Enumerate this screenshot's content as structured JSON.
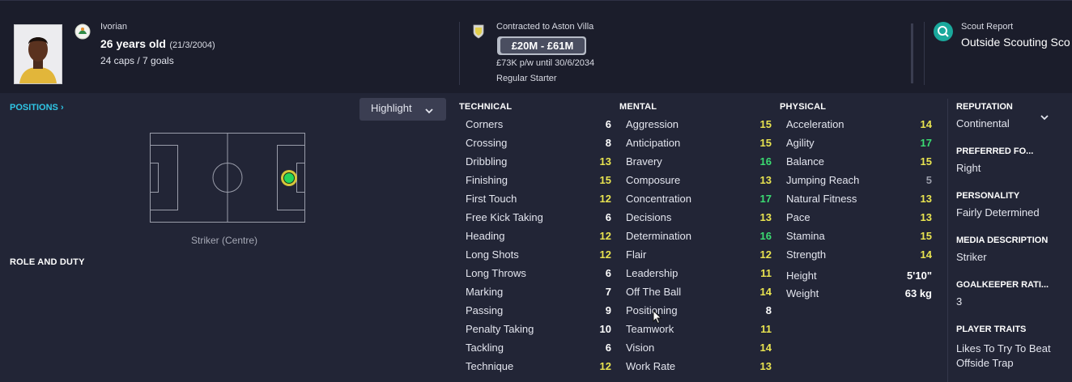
{
  "header": {
    "nationality": "Ivorian",
    "age_text": "26 years old",
    "dob_text": "(21/3/2004)",
    "caps_goals": "24 caps / 7 goals",
    "contract_label": "Contracted to Aston Villa",
    "value_range": "£20M - £61M",
    "wage_text": "£73K p/w until 30/6/2034",
    "squad_status": "Regular Starter",
    "scout_label": "Scout Report",
    "scout_value": "Outside Scouting Sco"
  },
  "left": {
    "positions_label": "POSITIONS",
    "highlight_label": "Highlight",
    "position_name": "Striker (Centre)",
    "role_duty_label": "ROLE AND DUTY"
  },
  "columns": {
    "technical": {
      "title": "TECHNICAL",
      "rows": [
        {
          "name": "Corners",
          "value": "6",
          "level": "white"
        },
        {
          "name": "Crossing",
          "value": "8",
          "level": "white"
        },
        {
          "name": "Dribbling",
          "value": "13",
          "level": "yellow"
        },
        {
          "name": "Finishing",
          "value": "15",
          "level": "yellow"
        },
        {
          "name": "First Touch",
          "value": "12",
          "level": "yellow"
        },
        {
          "name": "Free Kick Taking",
          "value": "6",
          "level": "white"
        },
        {
          "name": "Heading",
          "value": "12",
          "level": "yellow"
        },
        {
          "name": "Long Shots",
          "value": "12",
          "level": "yellow"
        },
        {
          "name": "Long Throws",
          "value": "6",
          "level": "white"
        },
        {
          "name": "Marking",
          "value": "7",
          "level": "white"
        },
        {
          "name": "Passing",
          "value": "9",
          "level": "white"
        },
        {
          "name": "Penalty Taking",
          "value": "10",
          "level": "white"
        },
        {
          "name": "Tackling",
          "value": "6",
          "level": "white"
        },
        {
          "name": "Technique",
          "value": "12",
          "level": "yellow"
        }
      ]
    },
    "mental": {
      "title": "MENTAL",
      "rows": [
        {
          "name": "Aggression",
          "value": "15",
          "level": "yellow"
        },
        {
          "name": "Anticipation",
          "value": "15",
          "level": "yellow"
        },
        {
          "name": "Bravery",
          "value": "16",
          "level": "green"
        },
        {
          "name": "Composure",
          "value": "13",
          "level": "yellow"
        },
        {
          "name": "Concentration",
          "value": "17",
          "level": "green"
        },
        {
          "name": "Decisions",
          "value": "13",
          "level": "yellow"
        },
        {
          "name": "Determination",
          "value": "16",
          "level": "green"
        },
        {
          "name": "Flair",
          "value": "12",
          "level": "yellow"
        },
        {
          "name": "Leadership",
          "value": "11",
          "level": "yellow"
        },
        {
          "name": "Off The Ball",
          "value": "14",
          "level": "yellow"
        },
        {
          "name": "Positioning",
          "value": "8",
          "level": "white"
        },
        {
          "name": "Teamwork",
          "value": "11",
          "level": "yellow"
        },
        {
          "name": "Vision",
          "value": "14",
          "level": "yellow"
        },
        {
          "name": "Work Rate",
          "value": "13",
          "level": "yellow"
        }
      ]
    },
    "physical": {
      "title": "PHYSICAL",
      "rows": [
        {
          "name": "Acceleration",
          "value": "14",
          "level": "yellow"
        },
        {
          "name": "Agility",
          "value": "17",
          "level": "green"
        },
        {
          "name": "Balance",
          "value": "15",
          "level": "yellow"
        },
        {
          "name": "Jumping Reach",
          "value": "5",
          "level": "grey"
        },
        {
          "name": "Natural Fitness",
          "value": "13",
          "level": "yellow"
        },
        {
          "name": "Pace",
          "value": "13",
          "level": "yellow"
        },
        {
          "name": "Stamina",
          "value": "15",
          "level": "yellow"
        },
        {
          "name": "Strength",
          "value": "14",
          "level": "yellow"
        }
      ],
      "height_label": "Height",
      "height_value": "5'10\"",
      "weight_label": "Weight",
      "weight_value": "63 kg"
    }
  },
  "info": {
    "reputation_label": "REPUTATION",
    "reputation_value": "Continental",
    "foot_label": "PREFERRED FO...",
    "foot_value": "Right",
    "personality_label": "PERSONALITY",
    "personality_value": "Fairly Determined",
    "media_label": "MEDIA DESCRIPTION",
    "media_value": "Striker",
    "gk_label": "GOALKEEPER RATI...",
    "gk_value": "3",
    "traits_label": "PLAYER TRAITS",
    "traits_value_1": "Likes To Try To Beat",
    "traits_value_2": "Offside Trap"
  },
  "colors": {
    "white": "#ffffff",
    "yellow": "#e9e450",
    "green": "#3bdc72",
    "grey": "#9a9daa",
    "accent": "#2fc6e6",
    "scout": "#1aa89c"
  },
  "icons": {
    "flag": "ivory-coast-badge-icon",
    "club": "aston-villa-badge-icon",
    "scout": "search-icon",
    "chevron": "chevron-down-icon",
    "positions": "chevron-right-icon"
  }
}
